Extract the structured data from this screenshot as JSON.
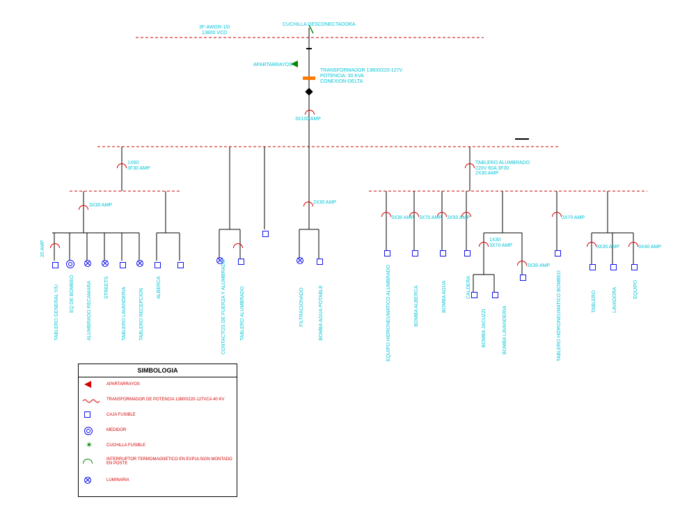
{
  "top_labels": {
    "incoming1": "3F-AWGR-1/0",
    "incoming2": "13800 VCD",
    "cuchilla": "CUCHILLA DESCONECTADORA",
    "apartarrayos": "APARTARRAYOS",
    "transformador1": "TRANSFORMADOR 13800/220-127V",
    "transformador2": "POTENCIA: 30 KVA",
    "transformador3": "CONEXION-DELTA",
    "main_amp": "3X100 AMP"
  },
  "branch_amps": {
    "b1": "1X60\n3F30 AMP",
    "b1a": "3X30 AMP",
    "b1_leaf": "20 AMP",
    "b2": "2X30 AMP",
    "b3": "TABLERO ALUMBRADO\n220V 60A 3F30\n2X30 AMP",
    "b3a": "3X30 AMP",
    "b3b": "3X70 AMP",
    "b3c": "3X50 AMP",
    "b3c_sub": "1X30\n3X70 AMP",
    "b3c_leaf": "3X30 AMP",
    "b3d": "3X70 AMP",
    "b3e": "3X30 AMP",
    "b3f": "3X40 AMP"
  },
  "leaf_labels": [
    "TABLERO GENERAL Y/U",
    "EQ DE BOMBEO",
    "ALUMBRADO RECAMARA",
    "STREETS",
    "TABLERO LAVANDERIA",
    "TABLERO RECEPCION",
    "ALBERCA",
    "CONTACTOS DE FUERZA Y ALUMBRADO",
    "TABLERO ALUMBRADO",
    "FILTRACIONADO",
    "BOMBA AGUA POTABLE",
    "EQUIPO HIDRONEUMATICO ALUMBRADO",
    "BOMBA ALBERCA",
    "BOMBA AGUA",
    "CALDERA",
    "BOMBA JACUZZI",
    "BOMBA LAVANDERIA",
    "TABLERO HIDRONEUMATICO BOMBEO",
    "TABLERO",
    "LAVADORA",
    "EQUIPO"
  ],
  "legend": {
    "title": "SIMBOLOGIA",
    "rows": [
      "APARTARRAYOS",
      "TRANSFORMADOR DE POTENCIA 13800/220-127VCA 40 KV",
      "CAJA FUSIBLE",
      "MEDIDOR",
      "CUCHILLA FUSIBLE",
      "INTERRUPTOR TERMOMAGNETICO EN EXPULSION MONTADO EN POSTE",
      "LUMINARIA"
    ]
  }
}
